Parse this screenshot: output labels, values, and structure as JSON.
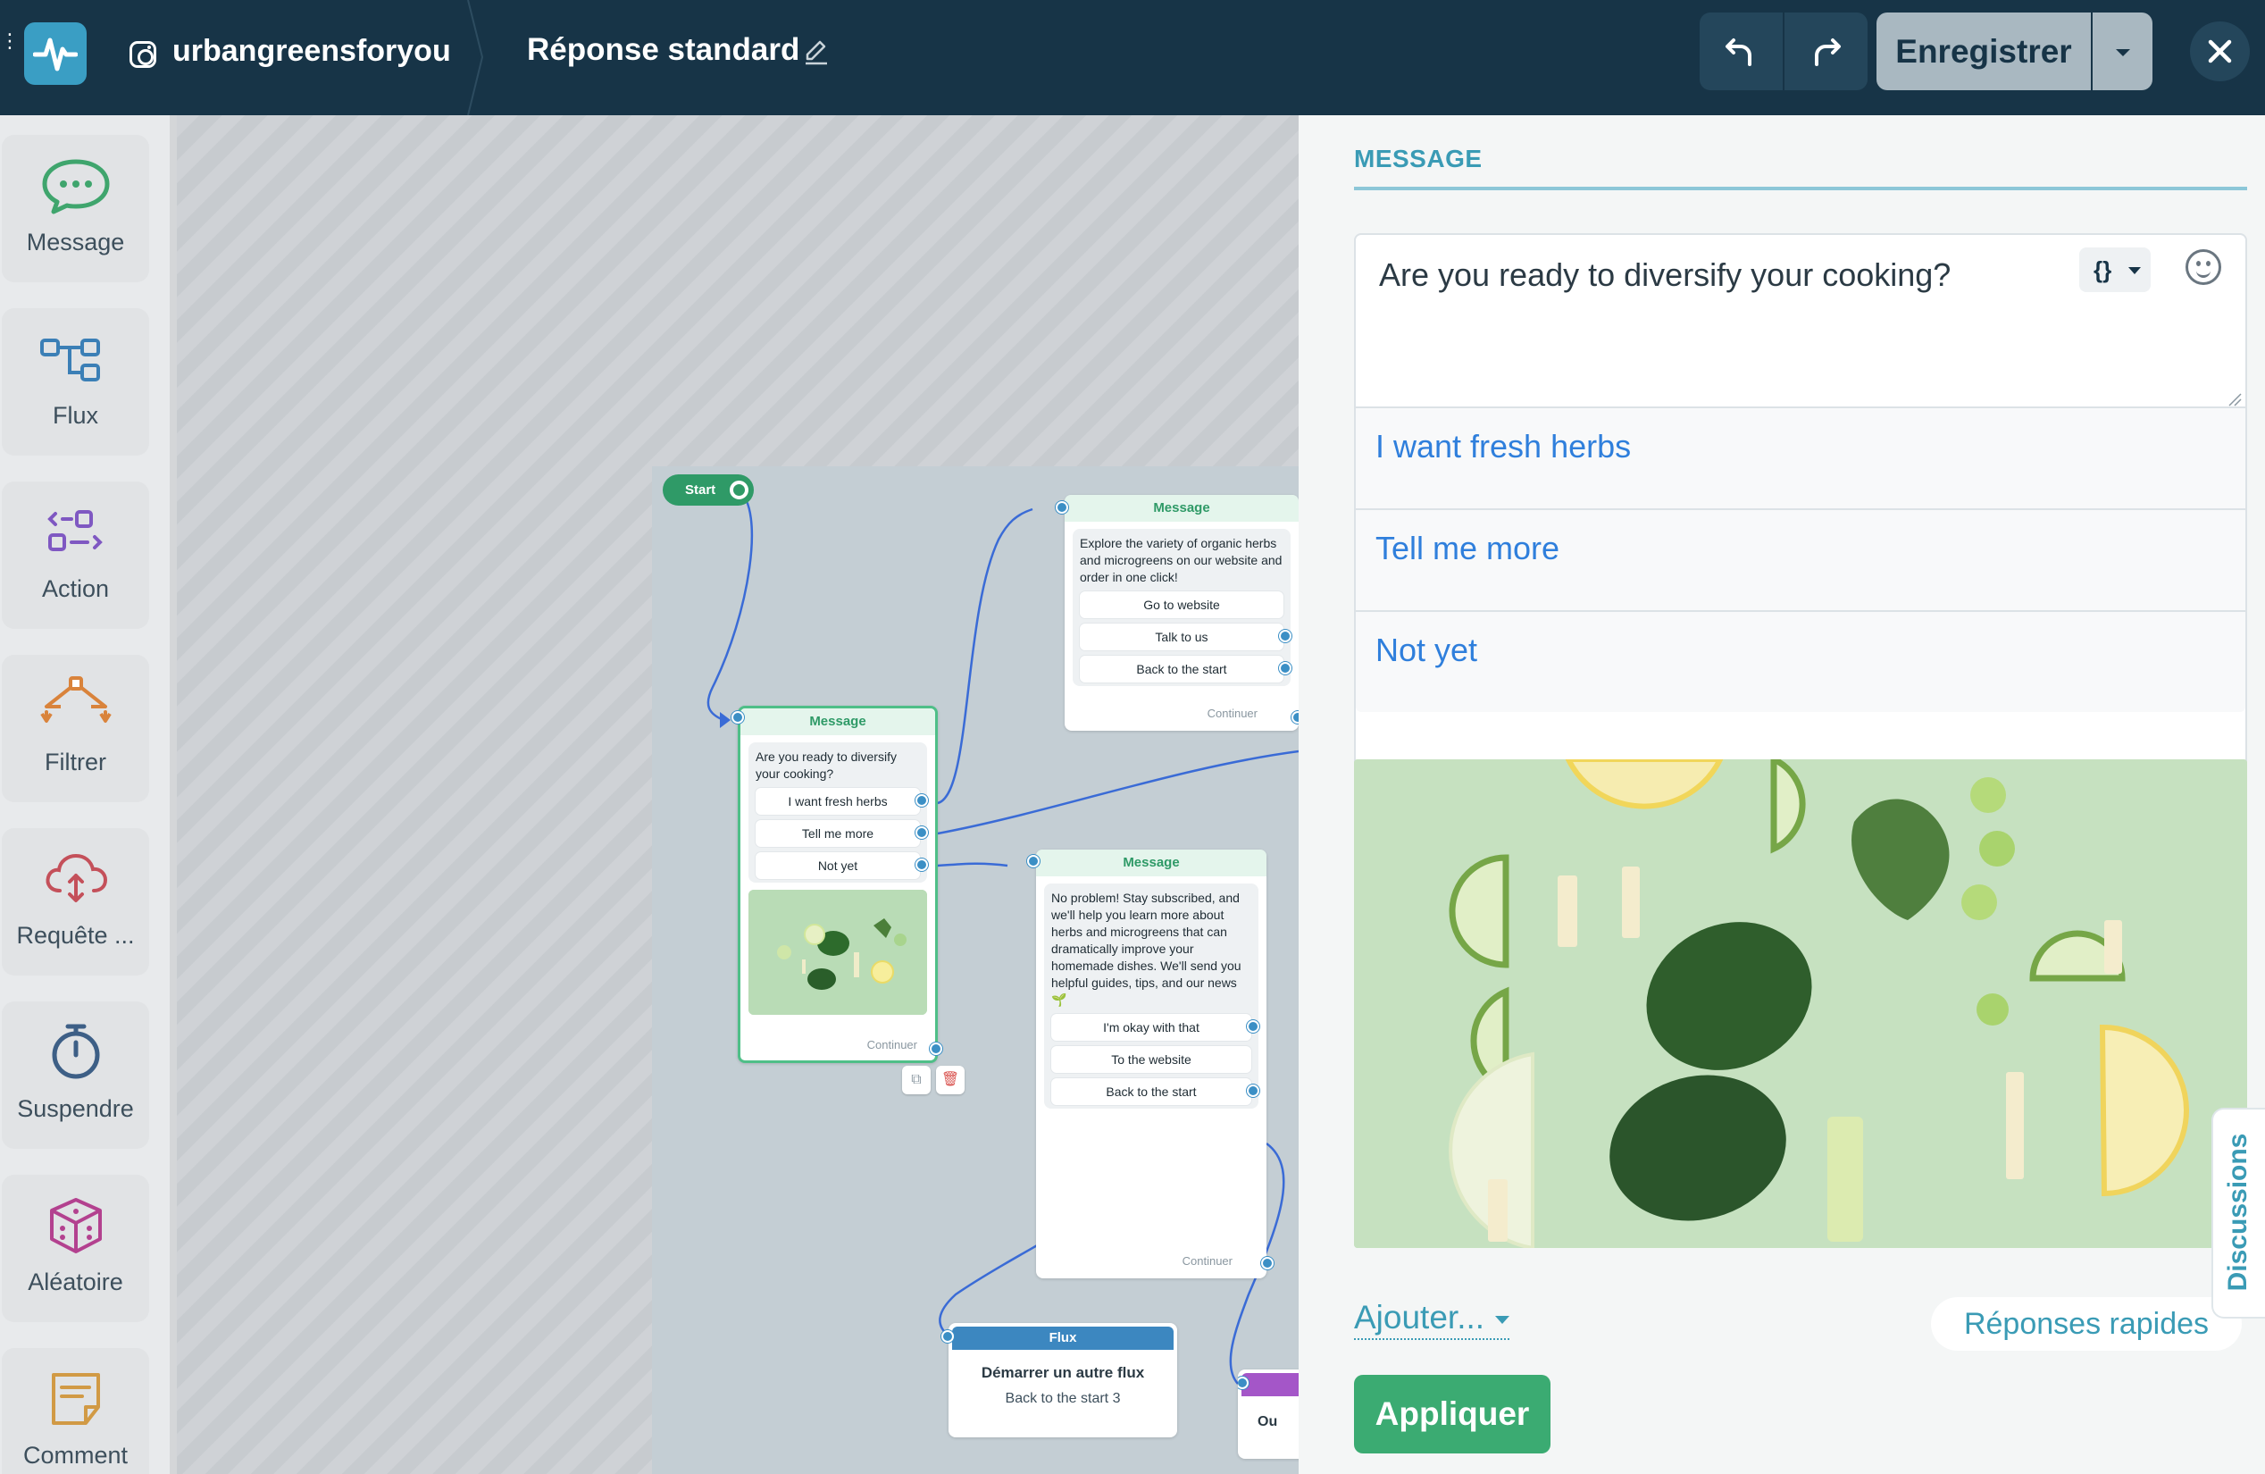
{
  "header": {
    "account_name": "urbangreensforyou",
    "flow_title": "Réponse standard",
    "save_label": "Enregistrer"
  },
  "palette": {
    "items": [
      {
        "label": "Message",
        "icon": "message-bubble-icon",
        "color": "#3fa56d"
      },
      {
        "label": "Flux",
        "icon": "flow-icon",
        "color": "#3b7fb6"
      },
      {
        "label": "Action",
        "icon": "action-icon",
        "color": "#7f58c2"
      },
      {
        "label": "Filtrer",
        "icon": "filter-icon",
        "color": "#d9833b"
      },
      {
        "label": "Requête ...",
        "icon": "cloud-request-icon",
        "color": "#c4505a"
      },
      {
        "label": "Suspendre",
        "icon": "timer-icon",
        "color": "#3d5f86"
      },
      {
        "label": "Aléatoire",
        "icon": "dice-icon",
        "color": "#b3418f"
      },
      {
        "label": "Comment",
        "icon": "note-icon",
        "color": "#d19a45"
      }
    ]
  },
  "canvas": {
    "start_label": "Start",
    "node_main": {
      "header": "Message",
      "text": "Are you ready to diversify your cooking?",
      "buttons": [
        "I want fresh herbs",
        "Tell me more",
        "Not yet"
      ],
      "footer": "Continuer"
    },
    "node_explore": {
      "header": "Message",
      "text": "Explore the variety of organic herbs and microgreens on our website and order in one click!",
      "buttons": [
        "Go to website",
        "Talk to us",
        "Back to the start"
      ],
      "footer": "Continuer"
    },
    "node_noproblem": {
      "header": "Message",
      "text": "No problem! Stay subscribed, and we'll help you learn more about herbs and microgreens that can dramatically improve your homemade dishes. We'll send you helpful guides, tips, and our news🌱",
      "buttons": [
        "I'm okay with that",
        "To the website",
        "Back to the start"
      ],
      "footer": "Continuer"
    },
    "node_flux": {
      "header": "Flux",
      "title": "Démarrer un autre flux",
      "subtitle": "Back to the start 3"
    },
    "node_partial": {
      "text": "Ou"
    }
  },
  "panel": {
    "section_title": "MESSAGE",
    "message_text": "Are you ready to diversify your cooking?",
    "variable_button": "{}",
    "quick_replies": [
      "I want fresh herbs",
      "Tell me more",
      "Not yet"
    ],
    "add_label": "Ajouter...",
    "quick_replies_button": "Réponses rapides",
    "apply_label": "Appliquer",
    "discussions_tab": "Discussions"
  },
  "colors": {
    "header_bg": "#173447",
    "accent_teal": "#3a9bb5",
    "apply_green": "#3bab72",
    "link_blue": "#2f7fdc"
  }
}
